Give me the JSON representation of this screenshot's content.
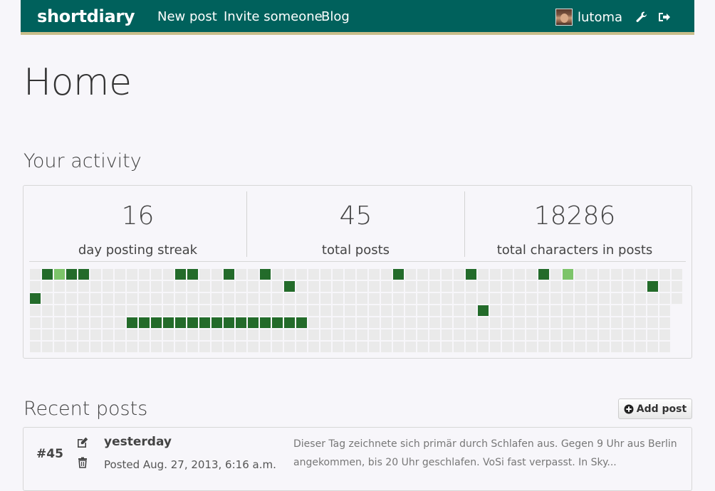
{
  "navbar": {
    "brand": "shortdiary",
    "links": [
      "New post",
      "Invite someone",
      "Blog"
    ],
    "username": "lutoma",
    "icons": [
      "wrench-icon",
      "logout-icon"
    ],
    "colors": {
      "background": "#00615c",
      "accent": "#c8bd8a"
    }
  },
  "page": {
    "title": "Home"
  },
  "activity": {
    "title": "Your activity",
    "stats": [
      {
        "value": "16",
        "label": "day posting streak"
      },
      {
        "value": "45",
        "label": "total posts"
      },
      {
        "value": "18286",
        "label": "total characters in posts"
      }
    ],
    "grid": {
      "columns": 54,
      "rows": 7,
      "last_column_rows": 3,
      "colors": {
        "empty": "#eaeaea",
        "posted": "#236b2a",
        "posted_light": "#7dc46a"
      },
      "active_cells": [
        {
          "col": 1,
          "row": 0,
          "level": 1
        },
        {
          "col": 2,
          "row": 0,
          "level": 2
        },
        {
          "col": 3,
          "row": 0,
          "level": 1
        },
        {
          "col": 4,
          "row": 0,
          "level": 1
        },
        {
          "col": 12,
          "row": 0,
          "level": 1
        },
        {
          "col": 13,
          "row": 0,
          "level": 1
        },
        {
          "col": 16,
          "row": 0,
          "level": 1
        },
        {
          "col": 19,
          "row": 0,
          "level": 1
        },
        {
          "col": 30,
          "row": 0,
          "level": 1
        },
        {
          "col": 36,
          "row": 0,
          "level": 1
        },
        {
          "col": 42,
          "row": 0,
          "level": 1
        },
        {
          "col": 44,
          "row": 0,
          "level": 2
        },
        {
          "col": 21,
          "row": 1,
          "level": 1
        },
        {
          "col": 51,
          "row": 1,
          "level": 1
        },
        {
          "col": 0,
          "row": 2,
          "level": 1
        },
        {
          "col": 37,
          "row": 3,
          "level": 1
        },
        {
          "col": 8,
          "row": 4,
          "level": 1
        },
        {
          "col": 9,
          "row": 4,
          "level": 1
        },
        {
          "col": 10,
          "row": 4,
          "level": 1
        },
        {
          "col": 11,
          "row": 4,
          "level": 1
        },
        {
          "col": 12,
          "row": 4,
          "level": 1
        },
        {
          "col": 13,
          "row": 4,
          "level": 1
        },
        {
          "col": 14,
          "row": 4,
          "level": 1
        },
        {
          "col": 15,
          "row": 4,
          "level": 1
        },
        {
          "col": 16,
          "row": 4,
          "level": 1
        },
        {
          "col": 17,
          "row": 4,
          "level": 1
        },
        {
          "col": 18,
          "row": 4,
          "level": 1
        },
        {
          "col": 19,
          "row": 4,
          "level": 1
        },
        {
          "col": 20,
          "row": 4,
          "level": 1
        },
        {
          "col": 21,
          "row": 4,
          "level": 1
        },
        {
          "col": 22,
          "row": 4,
          "level": 1
        }
      ]
    }
  },
  "recent_posts": {
    "title": "Recent posts",
    "add_button": "Add post",
    "posts": [
      {
        "number": "#45",
        "title": "yesterday",
        "meta": "Posted Aug. 27, 2013, 6:16 a.m.",
        "excerpt": "Dieser Tag zeichnete sich primär durch Schlafen aus. Gegen 9 Uhr aus Berlin angekommen, bis 20 Uhr geschlafen. VoSi fast verpasst. In Sky..."
      }
    ]
  }
}
